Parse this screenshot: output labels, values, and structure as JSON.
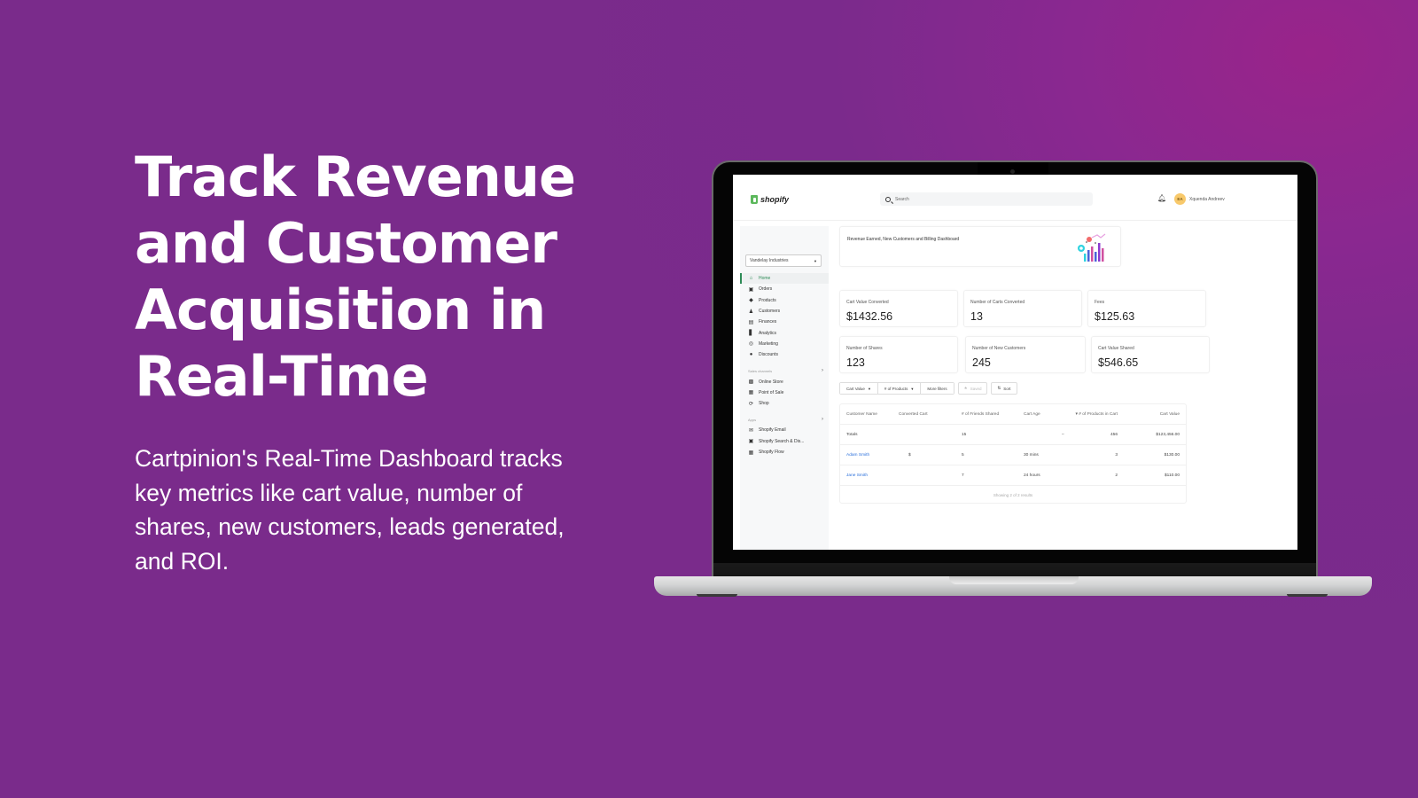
{
  "hero": {
    "headline_lines": [
      "Track Revenue",
      "and Customer",
      "Acquisition in",
      "Real-Time"
    ],
    "description": "Cartpinion's Real-Time Dashboard tracks key metrics like cart value, number of shares, new customers, leads generated, and ROI."
  },
  "colors": {
    "background": "#7a2b8b",
    "background_highlight": "#99248a",
    "accent_green": "#2e8b57",
    "link_blue": "#2a6fdb"
  },
  "app": {
    "logo_text": "shopify",
    "search_placeholder": "Search",
    "user_initials": "EA",
    "user_name": "Xquenda Andreev",
    "store_name": "Vandelay Industries",
    "nav_items": [
      {
        "label": "Home",
        "icon": "home-icon",
        "active": true
      },
      {
        "label": "Orders",
        "icon": "inbox-icon"
      },
      {
        "label": "Products",
        "icon": "tag-icon"
      },
      {
        "label": "Customers",
        "icon": "person-icon"
      },
      {
        "label": "Finances",
        "icon": "bank-icon"
      },
      {
        "label": "Analytics",
        "icon": "bar-chart-icon"
      },
      {
        "label": "Marketing",
        "icon": "target-icon"
      },
      {
        "label": "Discounts",
        "icon": "discount-icon"
      }
    ],
    "sales_channels_label": "Sales channels",
    "sales_channels": [
      {
        "label": "Online Store",
        "icon": "store-icon"
      },
      {
        "label": "Point of Sale",
        "icon": "pos-icon"
      },
      {
        "label": "Shop",
        "icon": "shop-icon"
      }
    ],
    "apps_label": "Apps",
    "apps": [
      {
        "label": "Shopify Email",
        "icon": "email-icon"
      },
      {
        "label": "Shopify Search & Dis...",
        "icon": "search-app-icon"
      },
      {
        "label": "Shopify Flow",
        "icon": "flow-icon"
      }
    ],
    "banner_title": "Revenue Earned, New Customers and Billing Dashboard",
    "metrics": [
      {
        "label": "Cart Value Converted",
        "value": "$1432.56"
      },
      {
        "label": "Number of Carts Converted",
        "value": "13"
      },
      {
        "label": "Fees",
        "value": "$125.63"
      },
      {
        "label": "Number of Shares",
        "value": "123"
      },
      {
        "label": "Number of New Customers",
        "value": "245"
      },
      {
        "label": "Cart Value Shared",
        "value": "$546.65"
      }
    ],
    "filters": {
      "cart_value": "Cart Value",
      "num_products": "# of Products",
      "more_filters": "More filters",
      "saved": "Saved",
      "sort": "Sort"
    },
    "table": {
      "headers": [
        "Customer Name",
        "Converted Cart",
        "# of Friends Shared",
        "Cart Age",
        "# of Products in Cart",
        "Cart Value"
      ],
      "totals": {
        "label": "Totals",
        "friends": "15",
        "age": "–",
        "products": "456",
        "value": "$123,456.00"
      },
      "rows": [
        {
          "name": "Adam Smith",
          "converted": "$",
          "friends": "5",
          "age": "30 mins",
          "products": "3",
          "value": "$130.00"
        },
        {
          "name": "Jane Smith",
          "converted": "",
          "friends": "7",
          "age": "24 hours",
          "products": "2",
          "value": "$110.00"
        }
      ],
      "footer": "Showing 2 of 2 results"
    }
  }
}
